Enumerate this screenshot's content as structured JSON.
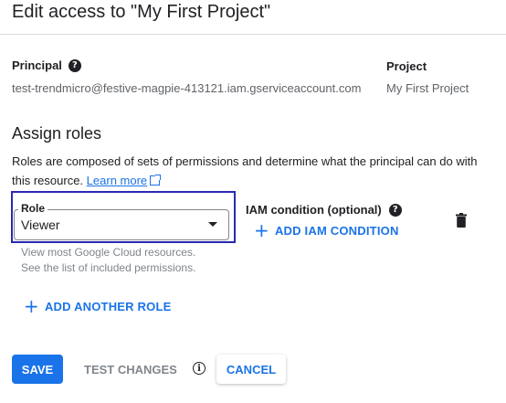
{
  "dialog": {
    "title": "Edit access to \"My First Project\""
  },
  "principal": {
    "header": "Principal",
    "value": "test-trendmicro@festive-magpie-413121.iam.gserviceaccount.com"
  },
  "project": {
    "header": "Project",
    "value": "My First Project"
  },
  "assign_roles": {
    "heading": "Assign roles",
    "description": "Roles are composed of sets of permissions and determine what the principal can do with this resource.",
    "learn_more": "Learn more"
  },
  "role": {
    "label": "Role",
    "value": "Viewer",
    "hint_line1": "View most Google Cloud resources.",
    "hint_line2": "See the list of included permissions."
  },
  "iam_condition": {
    "label": "IAM condition (optional)",
    "add_button": "ADD IAM CONDITION"
  },
  "add_another_role": "ADD ANOTHER ROLE",
  "footer": {
    "save": "SAVE",
    "test_changes": "TEST CHANGES",
    "cancel": "CANCEL"
  },
  "icons": {
    "help": "help-circle-icon",
    "external": "external-link-icon",
    "dropdown": "dropdown-arrow-icon",
    "add": "plus-icon",
    "delete": "trash-icon",
    "info": "info-icon"
  },
  "colors": {
    "accent": "#1a73e8",
    "highlight": "#2929b3",
    "muted": "#80868b"
  }
}
